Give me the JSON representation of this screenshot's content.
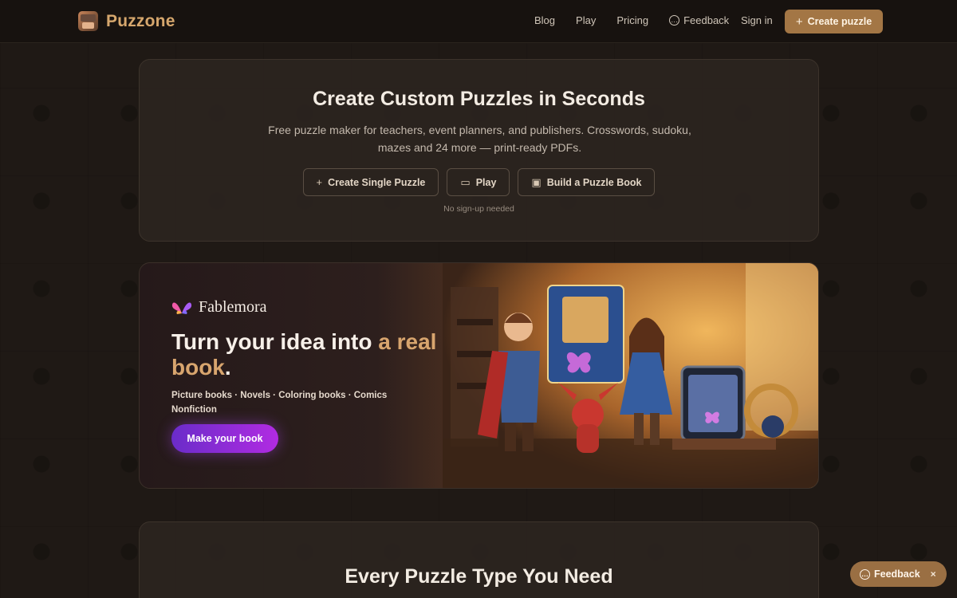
{
  "nav": {
    "brand": "Puzzone",
    "links": [
      "Blog",
      "Play",
      "Pricing",
      "Feedback"
    ],
    "signin": "Sign in",
    "create_button": "Create puzzle",
    "icons": {
      "brand": "puzzle-logo-icon",
      "feedback": "chat-icon",
      "create": "plus-icon"
    }
  },
  "hero": {
    "title": "Create Custom Puzzles in Seconds",
    "subtitle": "Free puzzle maker for teachers, event planners, and publishers. Crosswords, sudoku, mazes and 24 more — print-ready PDFs.",
    "buttons": [
      "Create Single Puzzle",
      "Play",
      "Build a Puzzle Book"
    ],
    "button_icons": [
      "plus-icon",
      "gamepad-icon",
      "book-icon"
    ],
    "note": "No sign-up needed"
  },
  "promo": {
    "brand": "Fablemora",
    "heading_main": "Turn your idea into ",
    "heading_gold1": "a real",
    "heading_gold2": "book",
    "heading_end": ".",
    "types_line1": "Picture books · Novels · Coloring books · Comics",
    "types_line2": "Nonfiction",
    "cta": "Make your book",
    "colors": {
      "accent": "#b12be2",
      "gold": "#d8a56e"
    }
  },
  "types_section": {
    "title": "Every Puzzle Type You Need"
  },
  "floating_feedback": {
    "label": "Feedback",
    "close": "×"
  }
}
